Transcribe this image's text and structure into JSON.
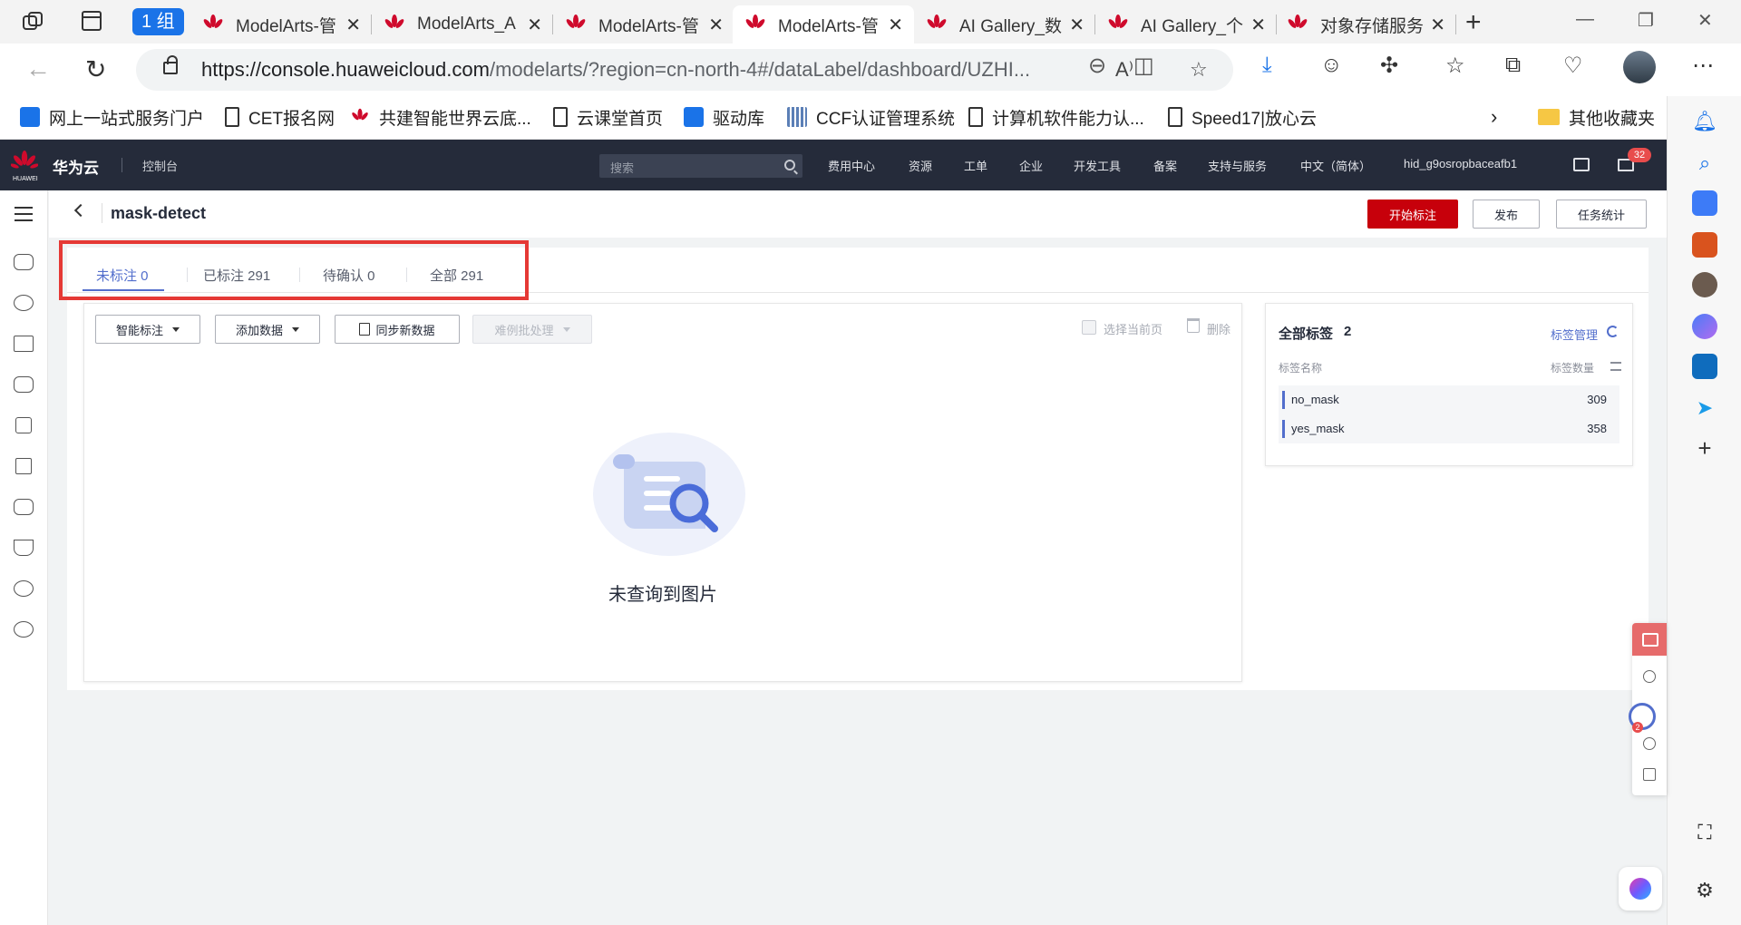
{
  "browser": {
    "group_chip": "1 组",
    "tabs": [
      {
        "title": "ModelArts-管",
        "active": false
      },
      {
        "title": "ModelArts_A",
        "active": false
      },
      {
        "title": "ModelArts-管",
        "active": false
      },
      {
        "title": "ModelArts-管",
        "active": true
      },
      {
        "title": "AI Gallery_数",
        "active": false
      },
      {
        "title": "AI Gallery_个",
        "active": false
      },
      {
        "title": "对象存储服务",
        "active": false
      }
    ],
    "url_host": "https://console.huaweicloud.com",
    "url_path": "/modelarts/?region=cn-north-4#/dataLabel/dashboard/UZHI...",
    "bookmarks": [
      {
        "label": "网上一站式服务门户",
        "icon": "blue"
      },
      {
        "label": "CET报名网",
        "icon": "doc"
      },
      {
        "label": "共建智能世界云底...",
        "icon": "huawei"
      },
      {
        "label": "云课堂首页",
        "icon": "doc"
      },
      {
        "label": "驱动库",
        "icon": "blue"
      },
      {
        "label": "CCF认证管理系统",
        "icon": "bar"
      },
      {
        "label": "计算机软件能力认...",
        "icon": "doc"
      },
      {
        "label": "Speed17|放心云",
        "icon": "doc"
      }
    ],
    "bookmarks_other": "其他收藏夹"
  },
  "console": {
    "brand": "华为云",
    "logo_text": "HUAWEI",
    "console_link": "控制台",
    "search_placeholder": "搜索",
    "nav": [
      "费用中心",
      "资源",
      "工单",
      "企业",
      "开发工具",
      "备案",
      "支持与服务",
      "中文（简体）",
      "hid_g9osropbaceafb1"
    ],
    "message_count": "32"
  },
  "page": {
    "title": "mask-detect",
    "actions": {
      "start_label": "开始标注",
      "publish_label": "发布",
      "stats_label": "任务统计"
    },
    "tabs": [
      {
        "label": "未标注 0",
        "active": true
      },
      {
        "label": "已标注 291",
        "active": false
      },
      {
        "label": "待确认 0",
        "active": false
      },
      {
        "label": "全部 291",
        "active": false
      }
    ],
    "toolbar": {
      "smart_label": "智能标注",
      "add_label": "添加数据",
      "sync_label": "同步新数据",
      "hard_label": "难例批处理",
      "select_page_label": "选择当前页",
      "delete_label": "删除"
    },
    "empty_text": "未查询到图片"
  },
  "labels_panel": {
    "title": "全部标签",
    "count": "2",
    "manage_label": "标签管理",
    "col_name": "标签名称",
    "col_count": "标签数量",
    "rows": [
      {
        "name": "no_mask",
        "count": "309"
      },
      {
        "name": "yes_mask",
        "count": "358"
      }
    ]
  },
  "floating": {
    "bot_badge": "2"
  },
  "colors": {
    "brand_red": "#c7000b",
    "accent_blue": "#526ecc",
    "header_bg": "#252b3a",
    "highlight_red": "#e53935"
  }
}
